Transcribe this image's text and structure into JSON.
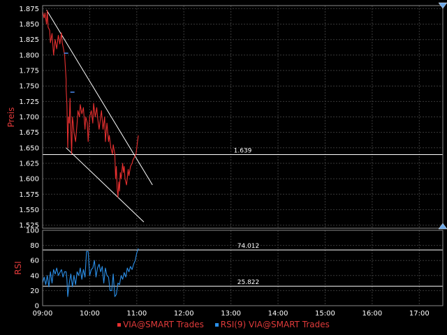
{
  "chart_data": [
    {
      "type": "line",
      "panel": "price",
      "ylabel": "Preis",
      "ylim": [
        1.52,
        1.88
      ],
      "ytick_values": [
        1.525,
        1.55,
        1.575,
        1.6,
        1.625,
        1.65,
        1.675,
        1.7,
        1.725,
        1.75,
        1.775,
        1.8,
        1.825,
        1.85,
        1.875
      ],
      "ytick_labels": [
        "1.525",
        "1.550",
        "1.575",
        "1.600",
        "1.625",
        "1.650",
        "1.675",
        "1.700",
        "1.725",
        "1.750",
        "1.775",
        "1.800",
        "1.825",
        "1.850",
        "1.875"
      ],
      "xlim": [
        "09:00",
        "17:30"
      ],
      "series": [
        {
          "name": "VIA@SMART Trades",
          "color": "#e83030",
          "x": [
            "09:00",
            "09:02",
            "09:03",
            "09:05",
            "09:06",
            "09:07",
            "09:09",
            "09:10",
            "09:12",
            "09:14",
            "09:16",
            "09:18",
            "09:20",
            "09:22",
            "09:24",
            "09:25",
            "09:27",
            "09:28",
            "09:29",
            "09:30",
            "09:30",
            "09:31",
            "09:32",
            "09:33",
            "09:34",
            "09:35",
            "09:36",
            "09:37",
            "09:38",
            "09:39",
            "09:40",
            "09:42",
            "09:44",
            "09:45",
            "09:47",
            "09:48",
            "09:50",
            "09:52",
            "09:54",
            "09:55",
            "09:57",
            "09:58",
            "10:00",
            "10:02",
            "10:04",
            "10:05",
            "10:07",
            "10:09",
            "10:10",
            "10:12",
            "10:14",
            "10:15",
            "10:17",
            "10:19",
            "10:20",
            "10:22",
            "10:24",
            "10:25",
            "10:27",
            "10:29",
            "10:30",
            "10:32",
            "10:33",
            "10:34",
            "10:35",
            "10:36",
            "10:37",
            "10:38",
            "10:39",
            "10:40",
            "10:42",
            "10:43",
            "10:44",
            "10:45",
            "10:47",
            "10:49",
            "10:50",
            "10:52",
            "10:54",
            "10:55",
            "10:57",
            "10:59",
            "11:00",
            "11:01",
            "11:02"
          ],
          "y": [
            1.87,
            1.86,
            1.868,
            1.85,
            1.872,
            1.845,
            1.84,
            1.82,
            1.835,
            1.8,
            1.825,
            1.81,
            1.832,
            1.818,
            1.836,
            1.82,
            1.808,
            1.8,
            1.78,
            1.76,
            1.745,
            1.72,
            1.65,
            1.7,
            1.69,
            1.73,
            1.68,
            1.64,
            1.7,
            1.69,
            1.675,
            1.66,
            1.69,
            1.71,
            1.7,
            1.72,
            1.705,
            1.715,
            1.68,
            1.7,
            1.69,
            1.66,
            1.7,
            1.71,
            1.69,
            1.722,
            1.7,
            1.715,
            1.7,
            1.68,
            1.7,
            1.71,
            1.68,
            1.7,
            1.66,
            1.69,
            1.66,
            1.67,
            1.65,
            1.64,
            1.655,
            1.64,
            1.6,
            1.62,
            1.585,
            1.57,
            1.595,
            1.58,
            1.61,
            1.6,
            1.625,
            1.61,
            1.62,
            1.6,
            1.59,
            1.615,
            1.605,
            1.62,
            1.625,
            1.63,
            1.635,
            1.64,
            1.65,
            1.66,
            1.67
          ]
        }
      ],
      "annotations": [
        {
          "type": "hline",
          "value": 1.639,
          "label": "1.639"
        },
        {
          "type": "trendline",
          "from": {
            "x": "09:05",
            "y": 1.873
          },
          "to": {
            "x": "11:20",
            "y": 1.59
          }
        },
        {
          "type": "trendline",
          "from": {
            "x": "09:30",
            "y": 1.65
          },
          "to": {
            "x": "11:09",
            "y": 1.53
          }
        }
      ],
      "markers": [
        {
          "x": "09:30",
          "y": 1.803,
          "color": "#4a8af0"
        },
        {
          "x": "09:38",
          "y": 1.74,
          "color": "#4a8af0"
        }
      ]
    },
    {
      "type": "line",
      "panel": "rsi",
      "ylabel": "RSI",
      "ylim": [
        0,
        100
      ],
      "ytick_values": [
        0,
        20,
        40,
        60,
        80,
        100
      ],
      "ytick_labels": [
        "0",
        "20",
        "40",
        "60",
        "80",
        "100"
      ],
      "xlim": [
        "09:00",
        "17:30"
      ],
      "series": [
        {
          "name": "RSI(9) VIA@SMART Trades",
          "color": "#2b8fe8",
          "x": [
            "09:00",
            "09:02",
            "09:04",
            "09:06",
            "09:08",
            "09:10",
            "09:12",
            "09:14",
            "09:16",
            "09:18",
            "09:20",
            "09:22",
            "09:24",
            "09:26",
            "09:28",
            "09:30",
            "09:31",
            "09:32",
            "09:34",
            "09:36",
            "09:38",
            "09:40",
            "09:42",
            "09:44",
            "09:46",
            "09:48",
            "09:50",
            "09:52",
            "09:54",
            "09:56",
            "09:58",
            "10:00",
            "10:02",
            "10:04",
            "10:06",
            "10:08",
            "10:10",
            "10:12",
            "10:14",
            "10:16",
            "10:18",
            "10:20",
            "10:22",
            "10:24",
            "10:26",
            "10:28",
            "10:30",
            "10:32",
            "10:34",
            "10:36",
            "10:38",
            "10:40",
            "10:42",
            "10:44",
            "10:46",
            "10:48",
            "10:50",
            "10:52",
            "10:54",
            "10:56",
            "10:58",
            "11:00",
            "11:02"
          ],
          "y": [
            30,
            38,
            28,
            40,
            25,
            45,
            30,
            48,
            42,
            50,
            40,
            44,
            48,
            38,
            45,
            45,
            35,
            12,
            30,
            42,
            25,
            40,
            28,
            45,
            40,
            50,
            35,
            48,
            38,
            72,
            72,
            40,
            48,
            50,
            60,
            38,
            50,
            55,
            45,
            52,
            30,
            50,
            40,
            38,
            20,
            20,
            42,
            12,
            15,
            30,
            28,
            40,
            35,
            44,
            38,
            50,
            45,
            52,
            48,
            55,
            60,
            70,
            76
          ]
        }
      ],
      "annotations": [
        {
          "type": "hline",
          "value": 74.012,
          "label": "74.012"
        },
        {
          "type": "hline",
          "value": 25.822,
          "label": "25.822"
        }
      ]
    }
  ],
  "x_axis": {
    "ticks": [
      "09:00",
      "10:00",
      "11:00",
      "12:00",
      "13:00",
      "14:00",
      "15:00",
      "16:00",
      "17:00"
    ]
  },
  "legend": {
    "items": [
      {
        "label": "VIA@SMART Trades",
        "color": "#e83030"
      },
      {
        "label": "RSI(9) VIA@SMART Trades",
        "color": "#2b8fe8"
      }
    ]
  },
  "colors": {
    "background": "#000000",
    "grid": "#3a3a3a",
    "axis_text": "#ffffff",
    "axis_label": "#e03a3a",
    "reference_line": "#ffffff",
    "scroll_arrow": "#6ea9e8"
  },
  "icons": {
    "top_right": "scroll-down-arrow-icon",
    "panel_right": "scroll-up-arrow-icon"
  }
}
